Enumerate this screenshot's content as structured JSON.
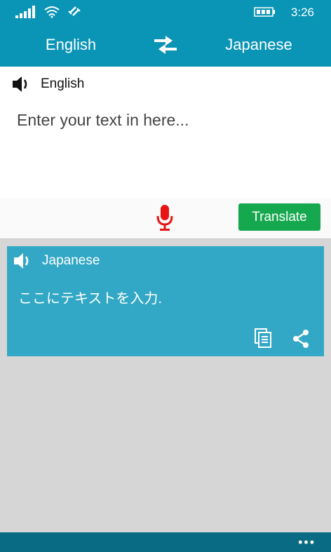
{
  "status": {
    "time": "3:26"
  },
  "languages": {
    "source": "English",
    "target": "Japanese"
  },
  "input": {
    "speaker_label": "English",
    "placeholder": "Enter your text in here..."
  },
  "actions": {
    "translate_label": "Translate"
  },
  "output": {
    "speaker_label": "Japanese",
    "text": "ここにテキストを入力."
  },
  "app_bar": {
    "more_label": "•••"
  },
  "colors": {
    "header": "#0a94b6",
    "output_panel": "#33a8c6",
    "translate_button": "#16a84f",
    "mic": "#e81414",
    "app_bar": "#0a6b84"
  }
}
